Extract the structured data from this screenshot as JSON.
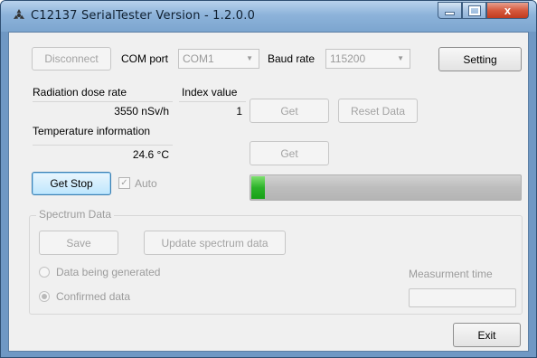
{
  "window": {
    "title": "C12137 SerialTester Version - 1.2.0.0",
    "close_glyph": "x"
  },
  "toolbar": {
    "disconnect_label": "Disconnect",
    "com_port_label": "COM port",
    "com_port_value": "COM1",
    "baud_rate_label": "Baud rate",
    "baud_rate_value": "115200",
    "setting_label": "Setting"
  },
  "radiation": {
    "label": "Radiation dose rate",
    "value": "3550 nSv/h"
  },
  "index": {
    "label": "Index value",
    "value": "1",
    "get_label": "Get",
    "reset_label": "Reset Data"
  },
  "temperature": {
    "label": "Temperature information",
    "value": "24.6 °C",
    "get_label": "Get"
  },
  "controls": {
    "get_stop_label": "Get Stop",
    "auto_label": "Auto",
    "auto_checked": true,
    "progress_percent": 5
  },
  "spectrum": {
    "title": "Spectrum Data",
    "save_label": "Save",
    "update_label": "Update spectrum data",
    "radio_generated_label": "Data being generated",
    "radio_confirmed_label": "Confirmed data",
    "selected": "confirmed",
    "measurement_time_label": "Measurment time",
    "measurement_time_value": ""
  },
  "footer": {
    "exit_label": "Exit"
  },
  "colors": {
    "progress_fill": "#2cb22a",
    "titlebar": "#8db3da",
    "close_button": "#c13a1e"
  },
  "icons": {
    "app": "app-icon",
    "minimize": "minimize-icon",
    "maximize": "maximize-icon",
    "close": "close-icon",
    "dropdown": "chevron-down-icon"
  }
}
